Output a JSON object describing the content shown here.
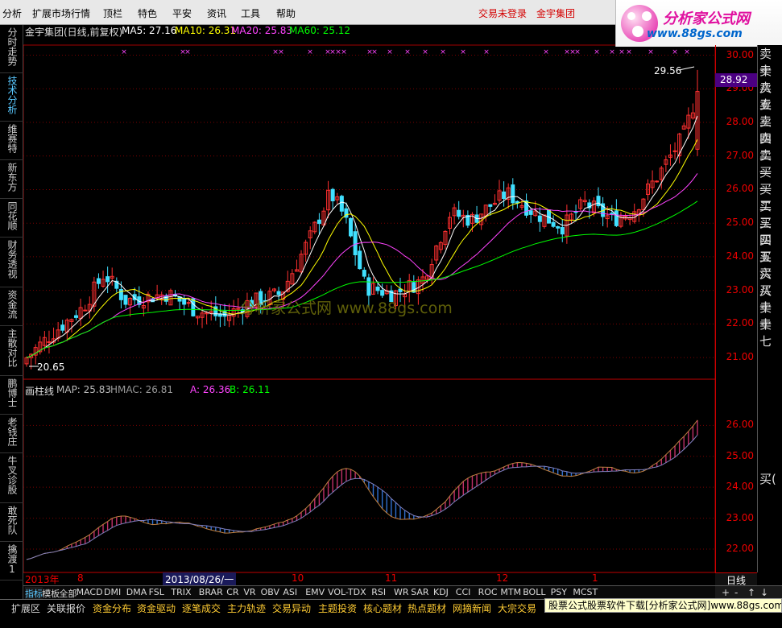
{
  "menu": {
    "items": [
      "分析",
      "扩展市场行情",
      "顶栏",
      "特色",
      "平安",
      "资讯",
      "工具",
      "帮助"
    ],
    "login_status": "交易未登录",
    "stock_name": "金宇集团"
  },
  "logo": {
    "title": "分析家公式网",
    "url": "www.88gs.com"
  },
  "left_tabs": [
    "分时走势",
    "技术分析",
    "维赛特",
    "新东方",
    "同花顺",
    "财务透视",
    "资金流",
    "主散对比",
    "鹏博士",
    "老钱庄",
    "牛叉诊股",
    "敢死队",
    "擒渡1"
  ],
  "active_left_tab": "技术分析",
  "price_chart": {
    "title": "金宇集团(日线,前复权)",
    "ma": [
      {
        "label": "MA5: 27.16",
        "color": "#ffffff"
      },
      {
        "label": "MA10: 26.31",
        "color": "#ffff00"
      },
      {
        "label": "MA20: 25.83",
        "color": "#ff44ff"
      },
      {
        "label": "MA60: 25.12",
        "color": "#00ff00"
      }
    ],
    "high_label": "29.56",
    "low_label": "20.65",
    "current_price": "28.92",
    "y_ticks": [
      "30.00",
      "29.00",
      "28.00",
      "27.00",
      "26.00",
      "25.00",
      "24.00",
      "23.00",
      "22.00",
      "21.00"
    ],
    "watermark": "分析家公式网 www.88gs.com"
  },
  "indicator_chart": {
    "name": "画柱线",
    "values": [
      {
        "label": "MAP: 25.83",
        "color": "#bbbbbb"
      },
      {
        "label": "HMAC: 26.81",
        "color": "#999999"
      },
      {
        "label": "A: 26.36",
        "color": "#ff44ff"
      },
      {
        "label": "B: 26.11",
        "color": "#00ff00"
      }
    ],
    "y_ticks": [
      "26.00",
      "25.00",
      "24.00",
      "23.00",
      "22.00"
    ]
  },
  "x_axis": {
    "dates": [
      "2013年",
      "8",
      "10",
      "11",
      "12",
      "1"
    ],
    "cursor_date": "2013/08/26/一",
    "period": "日线"
  },
  "order_book": [
    "卖十",
    "卖八",
    "卖五",
    "卖三",
    "卖四",
    "卖二",
    "卖一",
    "买一",
    "买二",
    "买三",
    "买四",
    "买五",
    "买六",
    "买八",
    "买十",
    "卖十",
    "卖七"
  ],
  "order_book_extra": "买(",
  "indicator_tabs": [
    "指标",
    "模板",
    "全部",
    "MACD",
    "DMI",
    "DMA",
    "FSL",
    "TRIX",
    "BRAR",
    "CR",
    "VR",
    "OBV",
    "ASI",
    "EMV",
    "VOL-TDX",
    "RSI",
    "WR",
    "SAR",
    "KDJ",
    "CCI",
    "ROC",
    "MTM",
    "BOLL",
    "PSY",
    "MCST"
  ],
  "bottom_bar": [
    "扩展区",
    "关联报价",
    "资金分布",
    "资金驱动",
    "逐笔成交",
    "主力轨迹",
    "交易异动",
    "主题投资",
    "核心题材",
    "热点题材",
    "网摘新闻",
    "大宗交易"
  ],
  "ad_text": "股票公式股票软件下载[分析家公式网]www.88gs.com",
  "chart_data": {
    "type": "candlestick",
    "title": "金宇集团(日线,前复权)",
    "ylim": [
      20.5,
      30.3
    ],
    "ma_last": {
      "MA5": 27.16,
      "MA10": 26.31,
      "MA20": 25.83,
      "MA60": 25.12
    },
    "close_last": 28.92,
    "period_high": 29.56,
    "period_low": 20.65,
    "indicator": {
      "name": "画柱线",
      "MAP": 25.83,
      "HMAC": 26.81,
      "A": 26.36,
      "B": 26.11,
      "ylim": [
        21.4,
        27.0
      ]
    }
  },
  "colors": {
    "up": "#ff3030",
    "down": "#40e0ff",
    "ma5": "#ffffff",
    "ma10": "#ffff00",
    "ma20": "#ff44ff",
    "ma60": "#00ff00",
    "grid": "#7a0000",
    "axis": "#e00000"
  }
}
